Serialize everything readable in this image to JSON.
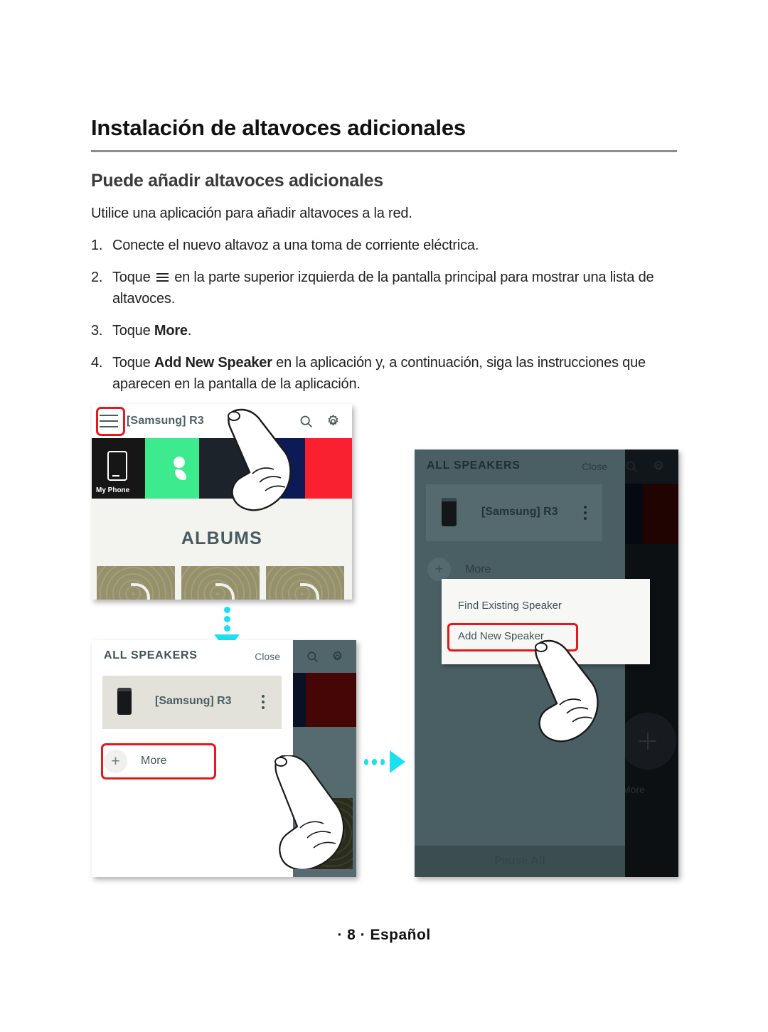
{
  "document": {
    "title": "Instalación de altavoces adicionales",
    "subtitle": "Puede añadir altavoces adicionales",
    "lead": "Utilice una aplicación para añadir altavoces a la red.",
    "footer": "· 8 · Español"
  },
  "steps": [
    {
      "num": "1.",
      "pre": "Conecte el nuevo altavoz a una toma de corriente eléctrica.",
      "bold": "",
      "post": ""
    },
    {
      "num": "2.",
      "pre": "Toque ",
      "bold": "",
      "post": " en la parte superior izquierda de la pantalla principal para mostrar una lista de altavoces."
    },
    {
      "num": "3.",
      "pre": "Toque ",
      "bold": "More",
      "post": "."
    },
    {
      "num": "4.",
      "pre": "Toque ",
      "bold": "Add New Speaker",
      "post": " en la aplicación y, a continuación, siga las instrucciones que aparecen en la pantalla de la aplicación."
    }
  ],
  "figures": {
    "shot_a": {
      "device_name": "[Samsung] R3",
      "menu_icon": "hamburger-icon",
      "search_icon": "search-icon",
      "settings_icon": "gear-icon",
      "tiles": [
        {
          "label": "My Phone",
          "color": "#161616"
        },
        {
          "label": "",
          "color": "#3dea8d"
        },
        {
          "label": "",
          "color": "#1d232b"
        },
        {
          "label": "",
          "color": "#0c1a55"
        },
        {
          "label": "",
          "color": "#f9212f"
        }
      ],
      "albums_heading": "ALBUMS",
      "album_thumbs": 3,
      "highlight_target": "hamburger-icon"
    },
    "shot_b": {
      "panel_title": "ALL SPEAKERS",
      "close_label": "Close",
      "speaker_name": "[Samsung] R3",
      "overflow_icon": "more-vertical-icon",
      "more_label": "More",
      "plus_icon": "plus-icon",
      "search_icon": "search-icon",
      "settings_icon": "gear-icon",
      "highlight_target": "more-button"
    },
    "shot_c": {
      "panel_title": "ALL SPEAKERS",
      "close_label": "Close",
      "speaker_name": "[Samsung] R3",
      "overflow_icon": "more-vertical-icon",
      "more_label": "More",
      "plus_icon": "plus-icon",
      "search_icon": "search-icon",
      "settings_icon": "gear-icon",
      "background_more_label": "More",
      "pause_all_label": "Pause All",
      "popup": {
        "item_find": "Find Existing Speaker",
        "item_add": "Add New Speaker",
        "highlight_target": "add-new-speaker-item"
      }
    },
    "arrows": {
      "down": "arrow-down-icon",
      "right": "arrow-right-icon",
      "color": "#1be0f0"
    },
    "highlight_color": "#e8161d"
  }
}
